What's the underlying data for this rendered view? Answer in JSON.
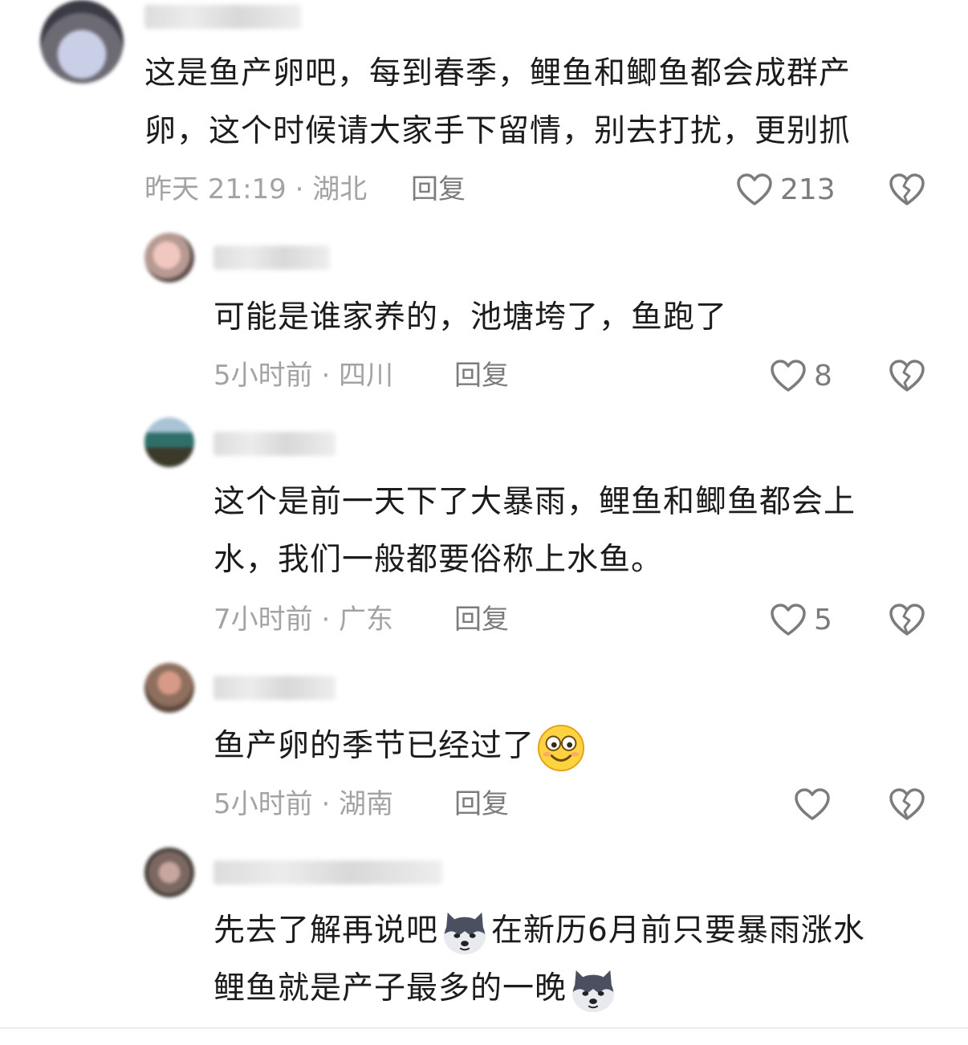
{
  "comments": [
    {
      "lines": [
        "这是鱼产卵吧，每到春季，鲤鱼和鲫鱼都会成群产",
        "卵，这个时候请大家手下留情，别去打扰，更别抓"
      ],
      "meta": "昨天 21:19 · 湖北",
      "reply": "回复",
      "likes": "213"
    },
    {
      "lines": [
        "可能是谁家养的，池塘垮了，鱼跑了"
      ],
      "meta": "5小时前 · 四川",
      "reply": "回复",
      "likes": "8"
    },
    {
      "lines": [
        "这个是前一天下了大暴雨，鲤鱼和鲫鱼都会上",
        "水，我们一般都要俗称上水鱼。"
      ],
      "meta": "7小时前 · 广东",
      "reply": "回复",
      "likes": "5"
    },
    {
      "line": "鱼产卵的季节已经过了",
      "meta": "5小时前 · 湖南",
      "reply": "回复",
      "likes": ""
    },
    {
      "line1_a": "先去了解再说吧",
      "line1_b": "在新历6月前只要暴雨涨水",
      "line2": "鲤鱼就是产子最多的一晚"
    }
  ],
  "icons": {
    "like": "heart-outline-icon",
    "dislike": "broken-heart-icon",
    "emoji_smile": "smiling-face-emoji",
    "emoji_dog": "husky-dog-emoji"
  },
  "colors": {
    "text": "#1c1c1c",
    "meta": "#a3a3a3",
    "reply": "#7c7c7c",
    "icon": "#7c7c7c"
  }
}
